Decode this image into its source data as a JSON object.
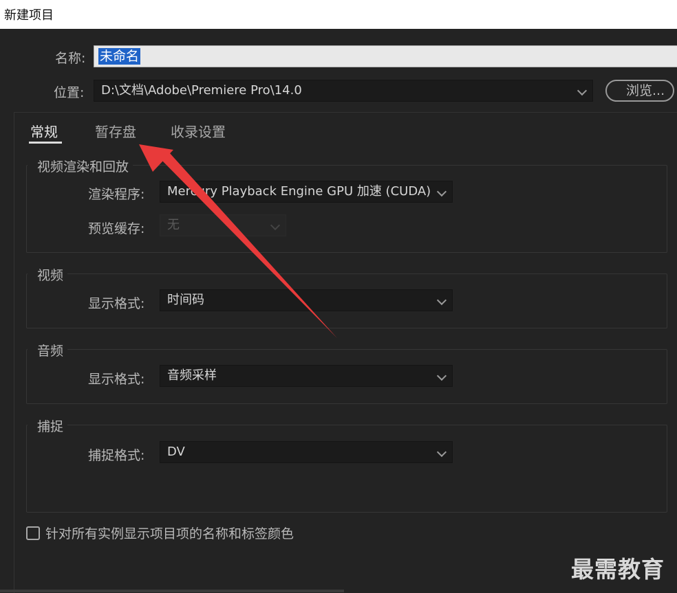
{
  "window": {
    "title": "新建项目"
  },
  "form": {
    "name_label": "名称:",
    "name_value": "未命名",
    "location_label": "位置:",
    "location_value": "D:\\文档\\Adobe\\Premiere Pro\\14.0",
    "browse_label": "浏览..."
  },
  "tabs": [
    {
      "label": "常规",
      "active": true
    },
    {
      "label": "暂存盘",
      "active": false
    },
    {
      "label": "收录设置",
      "active": false
    }
  ],
  "groups": {
    "render": {
      "title": "视频渲染和回放",
      "renderer_label": "渲染程序:",
      "renderer_value": "Mercury Playback Engine GPU 加速 (CUDA)",
      "preview_cache_label": "预览缓存:",
      "preview_cache_value": "无"
    },
    "video": {
      "title": "视频",
      "display_format_label": "显示格式:",
      "display_format_value": "时间码"
    },
    "audio": {
      "title": "音频",
      "display_format_label": "显示格式:",
      "display_format_value": "音频采样"
    },
    "capture": {
      "title": "捕捉",
      "capture_format_label": "捕捉格式:",
      "capture_format_value": "DV"
    }
  },
  "checkbox": {
    "label": "针对所有实例显示项目项的名称和标签颜色",
    "checked": false
  },
  "watermark": "最需教育",
  "colors": {
    "background": "#232323",
    "selection": "#1f63c8",
    "annotation_arrow": "#e83a3a"
  }
}
